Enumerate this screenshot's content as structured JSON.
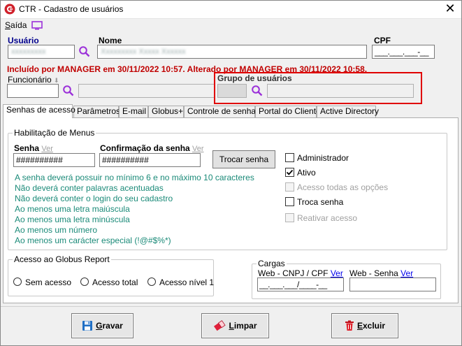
{
  "window": {
    "title": "CTR - Cadastro de usuários",
    "close_label": "✕"
  },
  "menu": {
    "saida_first": "S",
    "saida_rest": "aída"
  },
  "header": {
    "usuario_label": "Usuário",
    "usuario_value": "xxxxxxxxx",
    "nome_label": "Nome",
    "nome_value": "Xxxxxxxxx Xxxxx Xxxxxx",
    "cpf_label": "CPF",
    "cpf_mask": "___.___.___-__",
    "info_message": "Incluído por MANAGER em 30/11/2022 10:57. Alterado por MANAGER em 30/11/2022 10:58.",
    "funcionario_label": "Funcionário",
    "funcionario_value": "",
    "grupo_label": "Grupo de usuários",
    "grupo_code": "",
    "grupo_desc": ""
  },
  "tabs": [
    {
      "label": "Senhas de acesso",
      "active": true
    },
    {
      "label": "Parâmetros"
    },
    {
      "label": "E-mail"
    },
    {
      "label": "Globus+"
    },
    {
      "label": "Controle de senhas"
    },
    {
      "label": "Portal do Cliente"
    },
    {
      "label": "Active Directory"
    }
  ],
  "menus_group": {
    "title": "Habilitação de Menus",
    "senha_label": "Senha",
    "senha_ver": "Ver",
    "senha_value": "##########",
    "confirm_label": "Confirmação da senha",
    "confirm_ver": "Ver",
    "confirm_value": "##########",
    "trocar_button": "Trocar senha",
    "requirements": [
      "A senha deverá possuir no mínimo 6 e no máximo 10 caracteres",
      "Não deverá conter palavras acentuadas",
      "Não deverá conter o login do seu cadastro",
      "Ao menos uma letra maiúscula",
      "Ao menos uma letra minúscula",
      "Ao menos um número",
      "Ao menos um carácter especial (!@#$%*)"
    ],
    "checkboxes": [
      {
        "label": "Administrador",
        "checked": false,
        "enabled": true
      },
      {
        "label": "Ativo",
        "checked": true,
        "enabled": true
      },
      {
        "label": "Acesso todas as opções",
        "checked": false,
        "enabled": false
      },
      {
        "label": "Troca senha",
        "checked": false,
        "enabled": true
      },
      {
        "label": "Reativar acesso",
        "checked": false,
        "enabled": false
      }
    ]
  },
  "globus_report": {
    "title": "Acesso ao Globus Report",
    "options": [
      "Sem acesso",
      "Acesso total",
      "Acesso nível 1"
    ]
  },
  "cargas": {
    "title": "Cargas",
    "cnpj_label": "Web - CNPJ / CPF",
    "cnpj_ver": "Ver",
    "cnpj_mask": "__.___.___/____-__",
    "senha_label": "Web - Senha",
    "senha_ver": "Ver",
    "senha_value": ""
  },
  "footer": {
    "gravar_first": "G",
    "gravar_rest": "ravar",
    "limpar_first": "L",
    "limpar_rest": "impar",
    "excluir_first": "E",
    "excluir_rest": "xcluir"
  },
  "colors": {
    "info_red": "#c00000",
    "label_blue": "#00008b",
    "requirement_teal": "#1a8a78",
    "highlight_box": "#e00000",
    "accent_purple": "#9b30d9"
  }
}
